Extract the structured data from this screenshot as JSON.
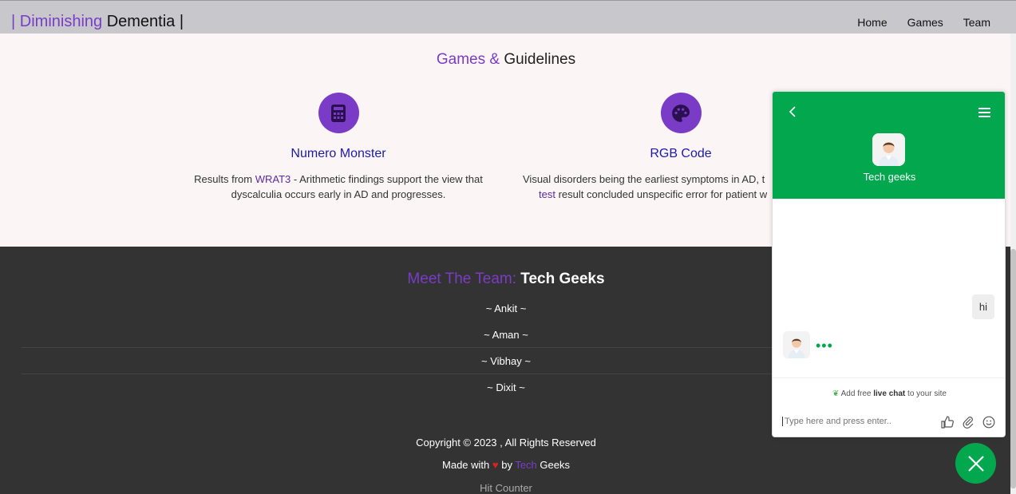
{
  "navbar": {
    "brand_pipe_left": "| ",
    "brand_part1": "Diminishing",
    "brand_part2": " Dementia |",
    "links": [
      "Home",
      "Games",
      "Team"
    ]
  },
  "games": {
    "title_part1": "Games &",
    "title_part2": " Guidelines",
    "cards": [
      {
        "icon": "calculator-icon",
        "name": "Numero Monster",
        "desc_prefix": "Results from ",
        "desc_link": "WRAT3",
        "desc_line1_rest": " - Arithmetic findings support the view that",
        "desc_line2": "dyscalculia occurs early in AD and progresses."
      },
      {
        "icon": "palette-icon",
        "name": "RGB Code",
        "desc_line1": "Visual disorders being the earliest symptoms in AD, t",
        "desc_link": "test",
        "desc_line2_rest": " result concluded unspecific error for patient w"
      }
    ]
  },
  "team": {
    "title_part1": "Meet The Team:",
    "title_part2": " Tech Geeks",
    "members": [
      "~ Ankit ~",
      "~ Aman ~",
      "~ Vibhay ~",
      "~ Dixit ~"
    ],
    "copyright": "Copyright © 2023 ,  All Rights Reserved",
    "made_with_prefix": "Made with ",
    "heart": "♥",
    "made_with_by": " by ",
    "made_with_tech": "Tech",
    "made_with_geeks": " Geeks",
    "hit_counter": "Hit Counter"
  },
  "chat": {
    "agent_name": "Tech geeks",
    "user_message": "hi",
    "typing": "•••",
    "promo_prefix": "Add free ",
    "promo_bold": "live chat",
    "promo_suffix": " to your site",
    "input_placeholder": "Type here and press enter.."
  },
  "colors": {
    "accent_purple": "#7a3cc7",
    "chat_green": "#03a84e",
    "footer_bg": "#333333",
    "link_blue": "#1a1ab0"
  }
}
